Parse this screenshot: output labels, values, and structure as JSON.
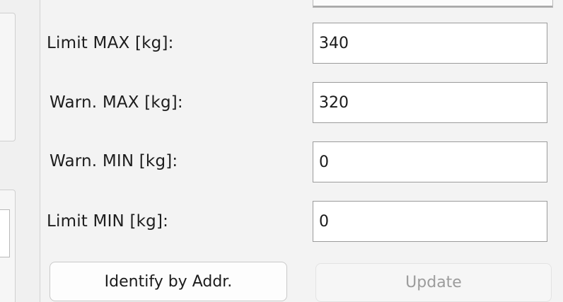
{
  "fields": [
    {
      "label": "Limit MAX [kg]:",
      "value": "340"
    },
    {
      "label": "Warn. MAX [kg]:",
      "value": "320"
    },
    {
      "label": "Warn. MIN [kg]:",
      "value": "0"
    },
    {
      "label": "Limit MIN [kg]:",
      "value": "0"
    }
  ],
  "buttons": {
    "identify_label": "Identify by Addr.",
    "update_label": "Update"
  },
  "colors": {
    "window_bg": "#f3f3f3",
    "input_border": "#9b9b9b",
    "disabled_text": "#9c9c9c"
  }
}
